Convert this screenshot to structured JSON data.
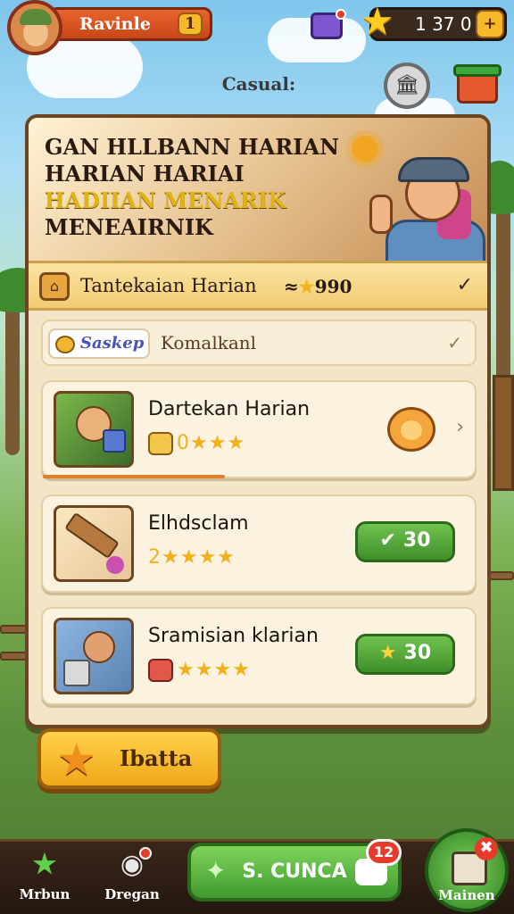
{
  "topbar": {
    "player_name": "Ravinle",
    "level_badge": "1",
    "star_count": "1  37  0",
    "plus": "+"
  },
  "header": {
    "mode_label": "Casual:",
    "round_button_icon": "🏛"
  },
  "hero": {
    "line1": "GAN HLLBANN HARIAN",
    "line2": "HARIAN HARIAI",
    "line3": "HADIIAN MENARIK",
    "line4": "MENEAIRNIK"
  },
  "daily": {
    "title": "Tantekaian Harian",
    "reward_prefix": "≈",
    "reward_star": "★",
    "reward_value": "990",
    "check": "✓"
  },
  "tabrow": {
    "chip_label": "Saskep",
    "label": "Komalkanl",
    "check": "✓"
  },
  "tasks": [
    {
      "title": "Dartekan Harian",
      "stars": "0★★★",
      "chevron": "›"
    },
    {
      "title": "Elhdsclam",
      "stars": "2★★★★",
      "reward_icon": "✔",
      "reward_value": "30"
    },
    {
      "title": "Sramisian klarian",
      "stars": "★★★★",
      "reward_icon": "★",
      "reward_value": "30"
    }
  ],
  "claim_button": {
    "label": "Ibatta",
    "icon": "★"
  },
  "bottomnav": {
    "item1_label": "Mrbun",
    "item1_icon": "★",
    "item2_label": "Dregan",
    "item2_icon": "◉",
    "play_label": "S. CUNCA",
    "play_icon": "✦",
    "badge": "12",
    "main_label": "Mainen",
    "main_x": "✖"
  },
  "colors": {
    "accent_green": "#3f9a2e",
    "accent_orange": "#e9642d",
    "gold": "#f2b11a",
    "panel": "#f3e6c8"
  }
}
